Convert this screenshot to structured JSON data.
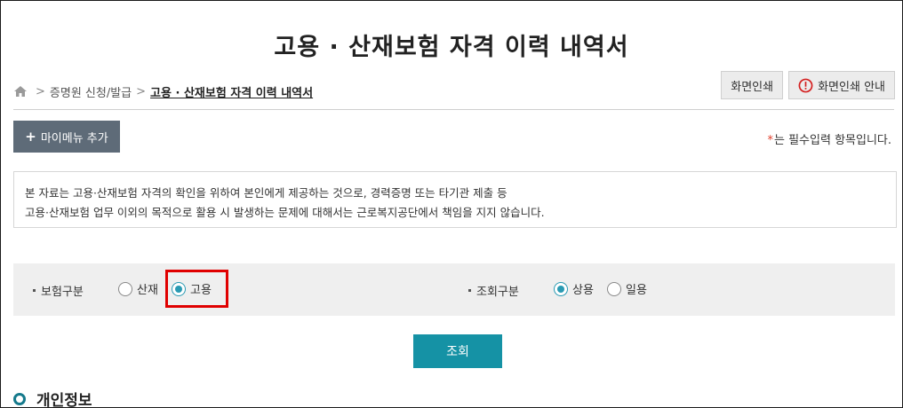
{
  "page": {
    "title": "고용 · 산재보험 자격 이력 내역서"
  },
  "breadcrumb": {
    "home_icon": "home-icon",
    "items": [
      "증명원 신청/발급",
      "고용 · 산재보험 자격 이력 내역서"
    ],
    "separator": ">"
  },
  "toolbar": {
    "print_label": "화면인쇄",
    "print_guide_label": "화면인쇄 안내",
    "print_guide_icon": "alert-circle-icon"
  },
  "mymenu": {
    "icon": "+",
    "label": "마이메뉴 추가"
  },
  "required_note": {
    "star": "*",
    "text": "는 필수입력 항목입니다."
  },
  "notice": {
    "line1": "본 자료는 고용·산재보험 자격의 확인을 위하여 본인에게 제공하는 것으로, 경력증명 또는 타기관 제출 등",
    "line2": "고용·산재보험 업무 이외의 목적으로 활용 시 발생하는 문제에 대해서는 근로복지공단에서 책임을 지지 않습니다."
  },
  "search": {
    "insurance_type": {
      "label": "보험구분",
      "options": [
        {
          "label": "산재",
          "checked": false
        },
        {
          "label": "고용",
          "checked": true
        }
      ]
    },
    "query_type": {
      "label": "조회구분",
      "options": [
        {
          "label": "상용",
          "checked": true
        },
        {
          "label": "일용",
          "checked": false
        }
      ]
    },
    "submit_label": "조회"
  },
  "section": {
    "title": "개인정보"
  },
  "colors": {
    "accent": "#1592a5",
    "dark_button": "#5e6b78",
    "radio_checked": "#2a9ab3",
    "highlight": "#e00000",
    "required_star": "#e2412e"
  }
}
